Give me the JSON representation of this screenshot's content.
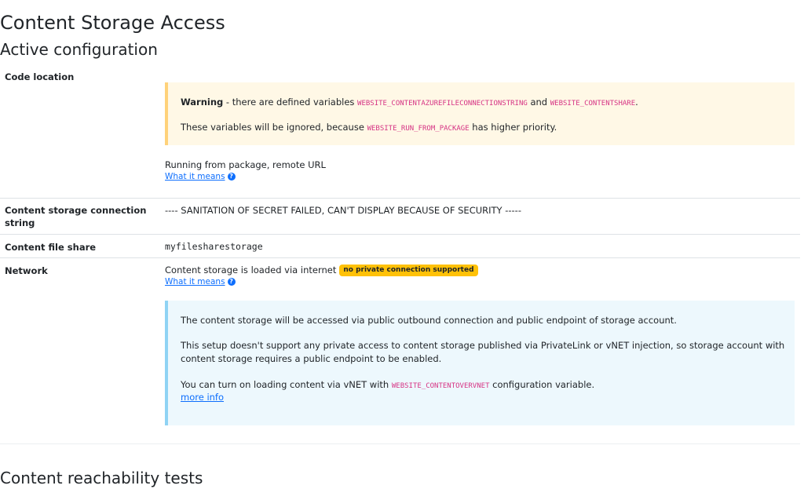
{
  "page": {
    "title": "Content Storage Access",
    "section_active": "Active configuration",
    "section_tests": "Content reachability tests"
  },
  "rows": {
    "code_location": {
      "label": "Code location",
      "warning": {
        "strong": "Warning",
        "text1": " - there are defined variables ",
        "var1": "WEBSITE_CONTENTAZUREFILECONNECTIONSTRING",
        "and": " and ",
        "var2": "WEBSITE_CONTENTSHARE",
        "dot": ".",
        "text2": "These variables will be ignored, because ",
        "var3": "WEBSITE_RUN_FROM_PACKAGE",
        "text3": " has higher priority."
      },
      "value": "Running from package, remote URL",
      "link": "What it means"
    },
    "connection_string": {
      "label_line1": "Content storage connection",
      "label_line2": "string",
      "value": "---- SANITATION OF SECRET FAILED, CAN'T DISPLAY BECAUSE OF SECURITY -----"
    },
    "file_share": {
      "label": "Content file share",
      "value": "myfilesharestorage"
    },
    "network": {
      "label": "Network",
      "value": "Content storage is loaded via internet",
      "badge": "no private connection supported",
      "link": "What it means",
      "info": {
        "p1": "The content storage will be accessed via public outbound connection and public endpoint of storage account.",
        "p2_line1": "This setup doesn't support any private access to content storage published via PrivateLink or vNET injection, so storage account with",
        "p2_line2": "content storage requires a public endpoint to be enabled.",
        "p3_text": "You can turn on loading content via vNET with ",
        "p3_var": "WEBSITE_CONTENTOVERVNET",
        "p3_tail": " configuration variable.",
        "more_link": "more info"
      }
    }
  },
  "icons": {
    "help": "question-circle-icon"
  },
  "colors": {
    "warning_bg": "#fff8e6",
    "warning_border": "#ffd27a",
    "info_bg": "#edf8fd",
    "info_border": "#8fd3f4",
    "badge": "#ffc107",
    "code": "#d63384",
    "link": "#0d6efd"
  }
}
